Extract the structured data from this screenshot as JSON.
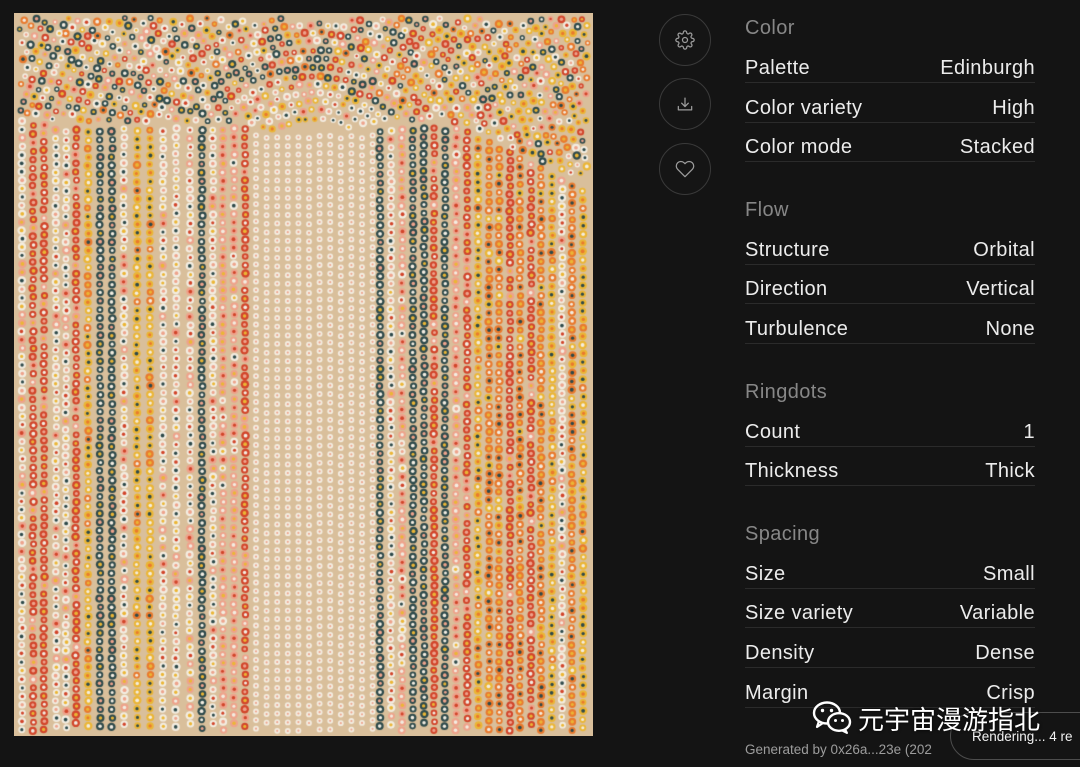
{
  "theme": {
    "page_bg": "#141414",
    "text": "#ececec",
    "muted": "#878787",
    "divider": "#2b2b2b"
  },
  "actions": {
    "settings_icon": "gear-icon",
    "download_icon": "download-icon",
    "favorite_icon": "heart-icon"
  },
  "artwork": {
    "background": "#d9bf9b",
    "palette": {
      "teal": "#2e4a4b",
      "red": "#d2452b",
      "orange": "#e97a2e",
      "yellow": "#ebb636",
      "cream": "#f3ede1",
      "pink": "#eea38c"
    }
  },
  "properties": {
    "sections": [
      {
        "title": "Color",
        "rows": [
          {
            "label": "Palette",
            "value": "Edinburgh"
          },
          {
            "label": "Color variety",
            "value": "High"
          },
          {
            "label": "Color mode",
            "value": "Stacked"
          }
        ]
      },
      {
        "title": "Flow",
        "rows": [
          {
            "label": "Structure",
            "value": "Orbital"
          },
          {
            "label": "Direction",
            "value": "Vertical"
          },
          {
            "label": "Turbulence",
            "value": "None"
          }
        ]
      },
      {
        "title": "Ringdots",
        "rows": [
          {
            "label": "Count",
            "value": "1"
          },
          {
            "label": "Thickness",
            "value": "Thick"
          }
        ]
      },
      {
        "title": "Spacing",
        "rows": [
          {
            "label": "Size",
            "value": "Small"
          },
          {
            "label": "Size variety",
            "value": "Variable"
          },
          {
            "label": "Density",
            "value": "Dense"
          },
          {
            "label": "Margin",
            "value": "Crisp"
          }
        ]
      }
    ]
  },
  "footer": {
    "generated_by": "Generated by 0x26a...23e (202"
  },
  "toast": {
    "text": "Rendering... 4 re"
  },
  "watermark": {
    "icon": "wechat-icon",
    "text": "元宇宙漫游指北"
  }
}
